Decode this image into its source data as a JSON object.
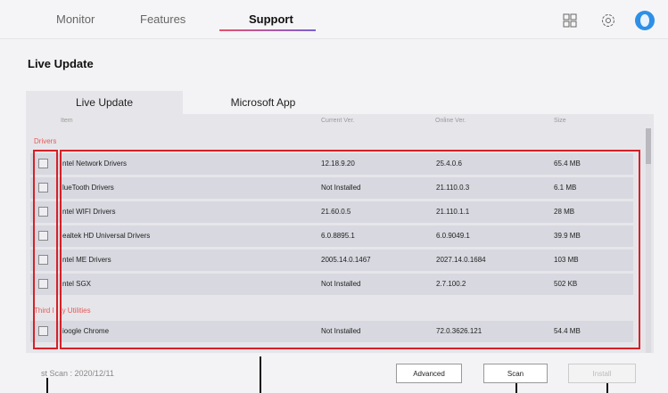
{
  "nav": {
    "tabs": [
      {
        "label": "Monitor"
      },
      {
        "label": "Features"
      },
      {
        "label": "Support"
      }
    ],
    "icons": [
      "grid-icon",
      "gear-icon",
      "avatar"
    ]
  },
  "page_title": "Live Update",
  "tabs": [
    {
      "label": "Live Update"
    },
    {
      "label": "Microsoft App"
    }
  ],
  "table": {
    "columns": [
      "Item",
      "Current Ver.",
      "Online Ver.",
      "Size"
    ],
    "sections": [
      {
        "label": "Drivers",
        "rows": [
          {
            "name": "ntel Network Drivers",
            "current": "12.18.9.20",
            "online": "25.4.0.6",
            "size": "65.4 MB"
          },
          {
            "name": "lueTooth Drivers",
            "current": "Not Installed",
            "online": "21.110.0.3",
            "size": "6.1 MB"
          },
          {
            "name": "ntel WIFI Drivers",
            "current": "21.60.0.5",
            "online": "21.110.1.1",
            "size": "28 MB"
          },
          {
            "name": "ealtek HD Universal Drivers",
            "current": "6.0.8895.1",
            "online": "6.0.9049.1",
            "size": "39.9 MB"
          },
          {
            "name": "ntel ME Drivers",
            "current": "2005.14.0.1467",
            "online": "2027.14.0.1684",
            "size": "103 MB"
          },
          {
            "name": "ntel SGX",
            "current": "Not Installed",
            "online": "2.7.100.2",
            "size": "502 KB"
          }
        ]
      },
      {
        "label": "Third I   ty Utilities",
        "rows": [
          {
            "name": "ioogle Chrome",
            "current": "Not Installed",
            "online": "72.0.3626.121",
            "size": "54.4 MB"
          }
        ]
      }
    ]
  },
  "footer": {
    "last_scan": "st Scan : 2020/12/11",
    "advanced": "Advanced",
    "scan": "Scan",
    "install": "Install"
  },
  "colors": {
    "accent_gradient_start": "#e8506a",
    "accent_gradient_end": "#7a5fd6",
    "highlight": "#d62027",
    "section_label": "#e45a5a"
  }
}
